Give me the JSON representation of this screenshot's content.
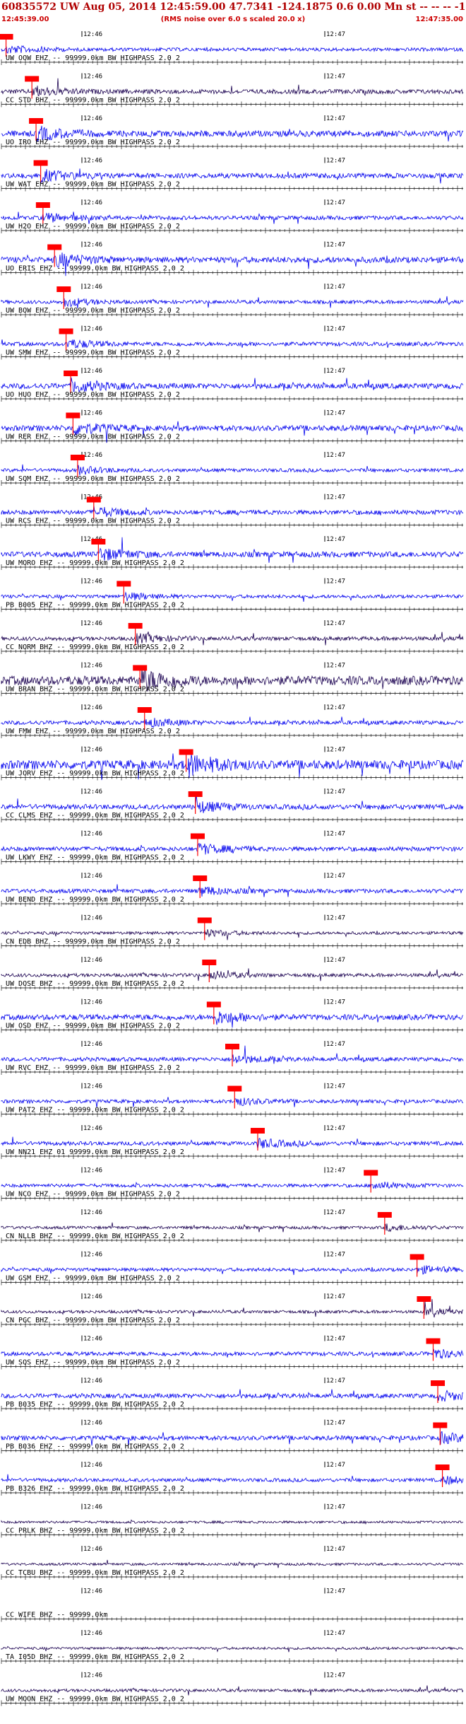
{
  "header": {
    "title": "60835572 UW Aug 05, 2014 12:45:59.00   47.7341 -124.1875  0.6 0.00 Mn st -- -- --  -1",
    "start_time": "12:45:39.00",
    "note": "(RMS noise over 6.0 s scaled 20.0 x)",
    "end_time": "12:47:35.00"
  },
  "chart_data": {
    "type": "line",
    "title": "60835572 UW Aug 05, 2014 12:45:59.00   47.7341 -124.1875  0.6 0.00 Mn st -- -- --  -1",
    "x_range": [
      "12:45:39.00",
      "12:47:35.00"
    ],
    "time_ticks": [
      "12:46",
      "12:47"
    ],
    "grid": false,
    "colors": {
      "trace_blue": "#0000ee",
      "trace_dark": "#1a0050",
      "pick": "#ff0000",
      "axis": "#000000"
    },
    "traces": [
      {
        "label": "UW OOW EHZ -- 99999.0km BW  HIGHPASS  2.0  2",
        "color": "blue",
        "amp": 0.35,
        "pick": 0.01
      },
      {
        "label": "CC STD BHZ -- 99999.0km BW  HIGHPASS  2.0  2",
        "color": "dark",
        "amp": 0.45,
        "pick": 0.066
      },
      {
        "label": "UO IRO EHZ -- 99999.0km BW  HIGHPASS  2.0  2",
        "color": "blue",
        "amp": 0.6,
        "pick": 0.075
      },
      {
        "label": "UW WAT EHZ -- 99999.0km BW  HIGHPASS  2.0  2",
        "color": "blue",
        "amp": 0.5,
        "pick": 0.085
      },
      {
        "label": "UW H2O EHZ -- 99999.0km BW  HIGHPASS  2.0  2",
        "color": "blue",
        "amp": 0.4,
        "pick": 0.09
      },
      {
        "label": "UO ERIS EHZ -- 99999.0km BW  HIGHPASS  2.0  2",
        "color": "blue",
        "amp": 0.6,
        "pick": 0.115
      },
      {
        "label": "UW BOW EHZ -- 99999.0km BW  HIGHPASS  2.0  2",
        "color": "blue",
        "amp": 0.35,
        "pick": 0.135
      },
      {
        "label": "UW SMW EHZ -- 99999.0km BW  HIGHPASS  2.0  2",
        "color": "blue",
        "amp": 0.4,
        "pick": 0.14
      },
      {
        "label": "UO HUO EHZ -- 99999.0km BW  HIGHPASS  2.0  2",
        "color": "blue",
        "amp": 0.55,
        "pick": 0.15
      },
      {
        "label": "UW RER EHZ -- 99999.0km BW  HIGHPASS  2.0  2",
        "color": "blue",
        "amp": 0.55,
        "pick": 0.155
      },
      {
        "label": "UW SQM EHZ -- 99999.0km BW  HIGHPASS  2.0  2",
        "color": "blue",
        "amp": 0.35,
        "pick": 0.165
      },
      {
        "label": "UW RCS EHZ -- 99999.0km BW  HIGHPASS  2.0  2",
        "color": "blue",
        "amp": 0.45,
        "pick": 0.2
      },
      {
        "label": "UW MORO EHZ -- 99999.0km BW  HIGHPASS  2.0  2",
        "color": "blue",
        "amp": 0.55,
        "pick": 0.21
      },
      {
        "label": "PB B005 EHZ -- 99999.0km BW  HIGHPASS  2.0  2",
        "color": "blue",
        "amp": 0.35,
        "pick": 0.265
      },
      {
        "label": "CC NORM BHZ -- 99999.0km BW  HIGHPASS  2.0  2",
        "color": "dark",
        "amp": 0.4,
        "pick": 0.29
      },
      {
        "label": "UW BRAN BHZ -- 99999.0km BW  HIGHPASS  2.0  2",
        "color": "dark",
        "amp": 0.9,
        "pick": 0.3
      },
      {
        "label": "UW FMW EHZ -- 99999.0km BW  HIGHPASS  2.0  2",
        "color": "blue",
        "amp": 0.4,
        "pick": 0.31
      },
      {
        "label": "UW JORV EHZ -- 99999.0km BW  HIGHPASS  2.0  2",
        "color": "blue",
        "amp": 0.9,
        "pick": 0.4
      },
      {
        "label": "CC CLMS EHZ -- 99999.0km BW  HIGHPASS  2.0  2",
        "color": "blue",
        "amp": 0.5,
        "pick": 0.42
      },
      {
        "label": "UW LKWY EHZ -- 99999.0km BW  HIGHPASS  2.0  2",
        "color": "blue",
        "amp": 0.45,
        "pick": 0.425
      },
      {
        "label": "UW BEND EHZ -- 99999.0km BW  HIGHPASS  2.0  2",
        "color": "blue",
        "amp": 0.4,
        "pick": 0.43
      },
      {
        "label": "CN EDB BHZ -- 99999.0km BW  HIGHPASS  2.0  2",
        "color": "dark",
        "amp": 0.3,
        "pick": 0.44
      },
      {
        "label": "UW DOSE BHZ -- 99999.0km BW  HIGHPASS  2.0  2",
        "color": "dark",
        "amp": 0.35,
        "pick": 0.45
      },
      {
        "label": "UW OSD EHZ -- 99999.0km BW  HIGHPASS  2.0  2",
        "color": "blue",
        "amp": 0.55,
        "pick": 0.46
      },
      {
        "label": "UW RVC EHZ -- 99999.0km BW  HIGHPASS  2.0  2",
        "color": "blue",
        "amp": 0.4,
        "pick": 0.5
      },
      {
        "label": "UW PAT2 EHZ -- 99999.0km BW  HIGHPASS  2.0  2",
        "color": "blue",
        "amp": 0.35,
        "pick": 0.505
      },
      {
        "label": "UW NN21 EHZ 01 99999.0km BW  HIGHPASS  2.0  2",
        "color": "blue",
        "amp": 0.4,
        "pick": 0.555
      },
      {
        "label": "UW NCO EHZ -- 99999.0km BW  HIGHPASS  2.0  2",
        "color": "blue",
        "amp": 0.35,
        "pick": 0.8
      },
      {
        "label": "CN NLLB BHZ -- 99999.0km BW  HIGHPASS  2.0  2",
        "color": "dark",
        "amp": 0.3,
        "pick": 0.83
      },
      {
        "label": "UW GSM EHZ -- 99999.0km BW  HIGHPASS  2.0  2",
        "color": "blue",
        "amp": 0.35,
        "pick": 0.9
      },
      {
        "label": "CN PGC BHZ -- 99999.0km BW  HIGHPASS  2.0  2",
        "color": "dark",
        "amp": 0.3,
        "pick": 0.915
      },
      {
        "label": "UW SQS EHZ -- 99999.0km BW  HIGHPASS  2.0  2",
        "color": "blue",
        "amp": 0.4,
        "pick": 0.935
      },
      {
        "label": "PB B035 EHZ -- 99999.0km BW  HIGHPASS  2.0  2",
        "color": "blue",
        "amp": 0.45,
        "pick": 0.945
      },
      {
        "label": "PB B036 EHZ -- 99999.0km BW  HIGHPASS  2.0  2",
        "color": "blue",
        "amp": 0.45,
        "pick": 0.95
      },
      {
        "label": "PB B326 EHZ -- 99999.0km BW  HIGHPASS  2.0  2",
        "color": "blue",
        "amp": 0.35,
        "pick": 0.955
      },
      {
        "label": "CC PRLK BHZ -- 99999.0km BW  HIGHPASS  2.0  2",
        "color": "dark",
        "amp": 0.25,
        "pick": null
      },
      {
        "label": "CC TCBU BHZ -- 99999.0km BW  HIGHPASS  2.0  2",
        "color": "dark",
        "amp": 0.25,
        "pick": null
      },
      {
        "label": "CC WIFE BHZ -- 99999.0km",
        "color": "dark",
        "amp": 0.0,
        "pick": null
      },
      {
        "label": "TA I05D BHZ -- 99999.0km BW  HIGHPASS  2.0  2",
        "color": "dark",
        "amp": 0.25,
        "pick": null
      },
      {
        "label": "UW MOON EHZ -- 99999.0km BW  HIGHPASS  2.0  2",
        "color": "dark",
        "amp": 0.3,
        "pick": null
      }
    ]
  }
}
